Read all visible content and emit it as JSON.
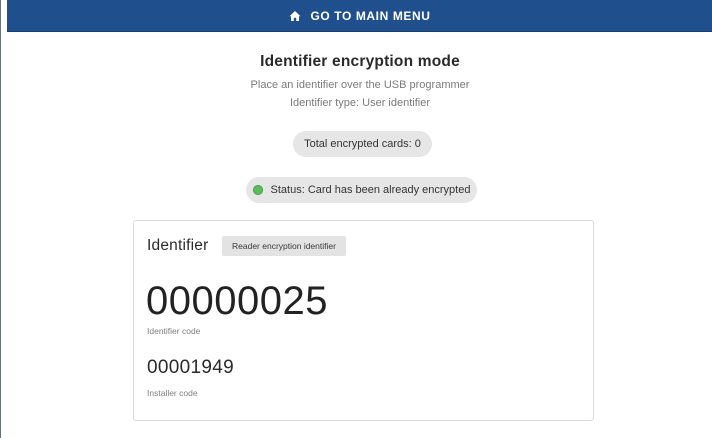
{
  "top_bar": {
    "icon": "home-icon",
    "label": "GO TO MAIN MENU",
    "background_color": "#1f4f8c"
  },
  "header": {
    "title": "Identifier encryption mode",
    "instruction": "Place an identifier over the USB programmer",
    "identifier_type": "Identifier type: User identifier"
  },
  "counters": {
    "total_encrypted": "Total encrypted cards: 0"
  },
  "status": {
    "text": "Status: Card has been already encrypted",
    "indicator_color": "#5dba5f"
  },
  "identifier_card": {
    "title": "Identifier",
    "chip": "Reader encryption identifier",
    "identifier_code": "00000025",
    "identifier_code_label": "Identifier code",
    "installer_code": "00001949",
    "installer_code_label": "Installer code"
  }
}
